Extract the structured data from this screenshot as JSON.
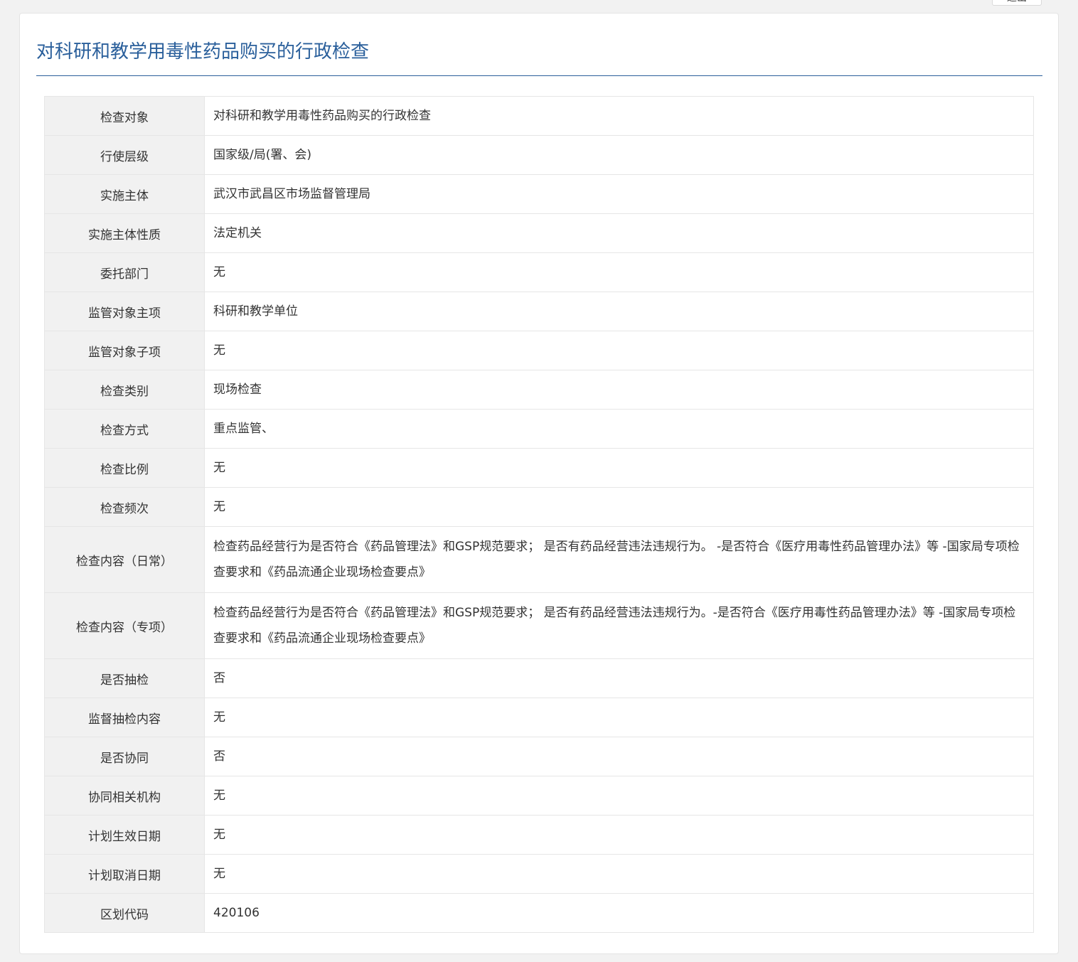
{
  "top_button": {
    "label": "退出"
  },
  "page": {
    "title": "对科研和教学用毒性药品购买的行政检查"
  },
  "rows": [
    {
      "label": "检查对象",
      "value": "对科研和教学用毒性药品购买的行政检查"
    },
    {
      "label": "行使层级",
      "value": "国家级/局(署、会)"
    },
    {
      "label": "实施主体",
      "value": "武汉市武昌区市场监督管理局"
    },
    {
      "label": "实施主体性质",
      "value": "法定机关"
    },
    {
      "label": "委托部门",
      "value": "无"
    },
    {
      "label": "监管对象主项",
      "value": "科研和教学单位"
    },
    {
      "label": "监管对象子项",
      "value": "无"
    },
    {
      "label": "检查类别",
      "value": "现场检查"
    },
    {
      "label": "检查方式",
      "value": "重点监管、"
    },
    {
      "label": "检查比例",
      "value": "无"
    },
    {
      "label": "检查频次",
      "value": "无"
    },
    {
      "label": "检查内容（日常）",
      "value": "检查药品经营行为是否符合《药品管理法》和GSP规范要求；  是否有药品经营违法违规行为。 -是否符合《医疗用毒性药品管理办法》等 -国家局专项检查要求和《药品流通企业现场检查要点》"
    },
    {
      "label": "检查内容（专项）",
      "value": "检查药品经营行为是否符合《药品管理法》和GSP规范要求；  是否有药品经营违法违规行为。-是否符合《医疗用毒性药品管理办法》等 -国家局专项检查要求和《药品流通企业现场检查要点》"
    },
    {
      "label": "是否抽检",
      "value": "否"
    },
    {
      "label": "监督抽检内容",
      "value": "无"
    },
    {
      "label": "是否协同",
      "value": "否"
    },
    {
      "label": "协同相关机构",
      "value": "无"
    },
    {
      "label": "计划生效日期",
      "value": "无"
    },
    {
      "label": "计划取消日期",
      "value": "无"
    },
    {
      "label": "区划代码",
      "value": "420106"
    }
  ]
}
